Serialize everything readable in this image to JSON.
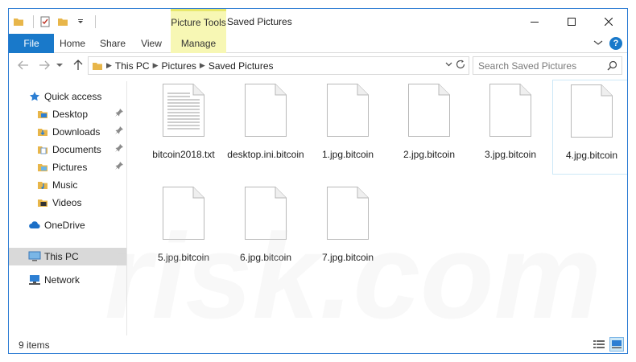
{
  "window": {
    "title": "Saved Pictures",
    "context_tab": "Picture Tools"
  },
  "ribbon": {
    "tabs": [
      {
        "label": "File"
      },
      {
        "label": "Home"
      },
      {
        "label": "Share"
      },
      {
        "label": "View"
      },
      {
        "label": "Manage"
      }
    ]
  },
  "address": {
    "crumbs": [
      "This PC",
      "Pictures",
      "Saved Pictures"
    ]
  },
  "search": {
    "placeholder": "Search Saved Pictures"
  },
  "sidebar": {
    "items": [
      {
        "label": "Quick access",
        "icon": "star-icon"
      },
      {
        "label": "Desktop",
        "icon": "desktop-folder-icon",
        "pinned": true
      },
      {
        "label": "Downloads",
        "icon": "downloads-folder-icon",
        "pinned": true
      },
      {
        "label": "Documents",
        "icon": "documents-folder-icon",
        "pinned": true
      },
      {
        "label": "Pictures",
        "icon": "pictures-folder-icon",
        "pinned": true
      },
      {
        "label": "Music",
        "icon": "music-folder-icon"
      },
      {
        "label": "Videos",
        "icon": "videos-folder-icon"
      },
      {
        "label": "OneDrive",
        "icon": "cloud-icon"
      },
      {
        "label": "This PC",
        "icon": "computer-icon",
        "selected": true
      },
      {
        "label": "Network",
        "icon": "network-icon"
      }
    ]
  },
  "files": [
    {
      "name": "bitcoin2018.txt",
      "type": "text"
    },
    {
      "name": "desktop.ini.bitcoin",
      "type": "blank"
    },
    {
      "name": "1.jpg.bitcoin",
      "type": "blank"
    },
    {
      "name": "2.jpg.bitcoin",
      "type": "blank"
    },
    {
      "name": "3.jpg.bitcoin",
      "type": "blank"
    },
    {
      "name": "4.jpg.bitcoin",
      "type": "blank",
      "selected": true
    },
    {
      "name": "5.jpg.bitcoin",
      "type": "blank"
    },
    {
      "name": "6.jpg.bitcoin",
      "type": "blank"
    },
    {
      "name": "7.jpg.bitcoin",
      "type": "blank"
    }
  ],
  "status": {
    "item_count": "9 items"
  },
  "watermark": {
    "text": "risk.com"
  },
  "colors": {
    "accent": "#1979ca",
    "context_tab": "#f7f7b4",
    "selection": "#cde8f7",
    "folder": "#e8b64a"
  }
}
